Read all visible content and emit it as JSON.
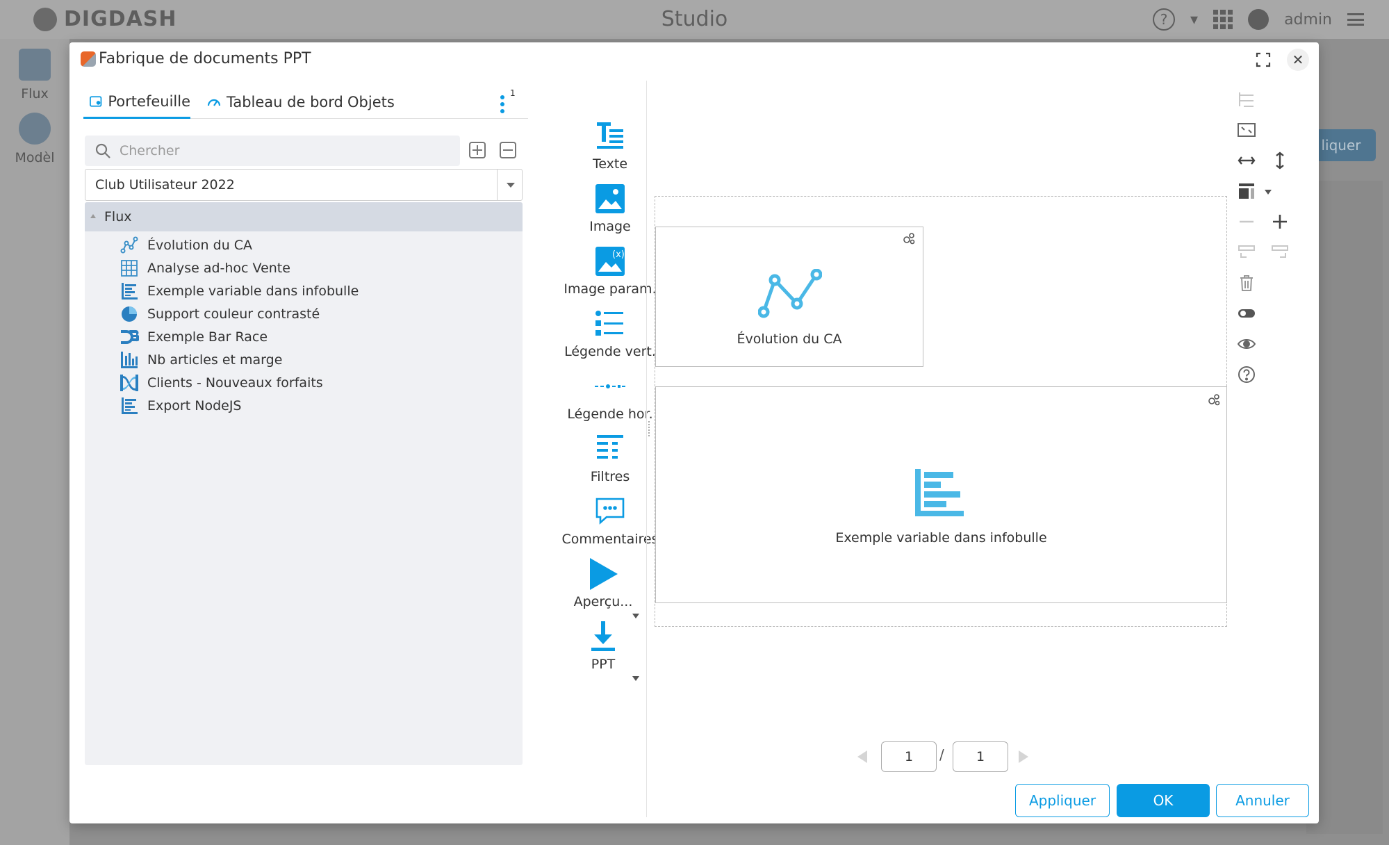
{
  "background": {
    "brand": "DIGDASH",
    "title": "Studio",
    "user": "admin",
    "nav": [
      {
        "label": "Flux"
      },
      {
        "label": "Modèl"
      }
    ],
    "right_button": "liquer"
  },
  "dialog": {
    "title": "Fabrique de documents PPT",
    "tabs": [
      {
        "label": "Portefeuille",
        "icon": "folder-icon",
        "active": true
      },
      {
        "label": "Tableau de bord",
        "icon": "gauge-icon",
        "active": false
      },
      {
        "label": "Objets",
        "active": false
      }
    ],
    "menu_badge": "1",
    "search": {
      "placeholder": "Chercher",
      "value": ""
    },
    "folder_select": "Club Utilisateur 2022",
    "tree": {
      "root": "Flux",
      "items": [
        {
          "label": "Évolution du CA",
          "icon": "line-chart-icon"
        },
        {
          "label": "Analyse ad-hoc Vente",
          "icon": "grid-table-icon"
        },
        {
          "label": "Exemple variable dans infobulle",
          "icon": "horizontal-bar-icon"
        },
        {
          "label": "Support couleur contrasté",
          "icon": "pie-chart-icon"
        },
        {
          "label": "Exemple Bar Race",
          "icon": "d3-icon"
        },
        {
          "label": "Nb articles et marge",
          "icon": "vertical-bar-icon"
        },
        {
          "label": "Clients - Nouveaux forfaits",
          "icon": "sankey-icon"
        },
        {
          "label": "Export NodeJS",
          "icon": "horizontal-bar-icon"
        }
      ]
    },
    "palette": [
      {
        "label": "Texte",
        "icon": "text-icon"
      },
      {
        "label": "Image",
        "icon": "image-icon"
      },
      {
        "label": "Image param.",
        "icon": "image-param-icon"
      },
      {
        "label": "Légende vert.",
        "icon": "legend-vertical-icon"
      },
      {
        "label": "Légende hor.",
        "icon": "legend-horizontal-icon"
      },
      {
        "label": "Filtres",
        "icon": "filters-icon"
      },
      {
        "label": "Commentaires",
        "icon": "comment-icon"
      },
      {
        "label": "Aperçu...",
        "icon": "play-icon"
      },
      {
        "label": "PPT",
        "icon": "download-icon"
      }
    ],
    "canvas": {
      "blocks": [
        {
          "label": "Évolution du CA",
          "icon": "line-chart-icon"
        },
        {
          "label": "Exemple variable dans infobulle",
          "icon": "horizontal-bar-icon"
        }
      ]
    },
    "pagination": {
      "current": "1",
      "separator": "/",
      "total": "1"
    },
    "buttons": {
      "apply": "Appliquer",
      "ok": "OK",
      "cancel": "Annuler"
    },
    "colors": {
      "accent": "#0a9be3",
      "block_icon": "#4ab8e6"
    }
  }
}
